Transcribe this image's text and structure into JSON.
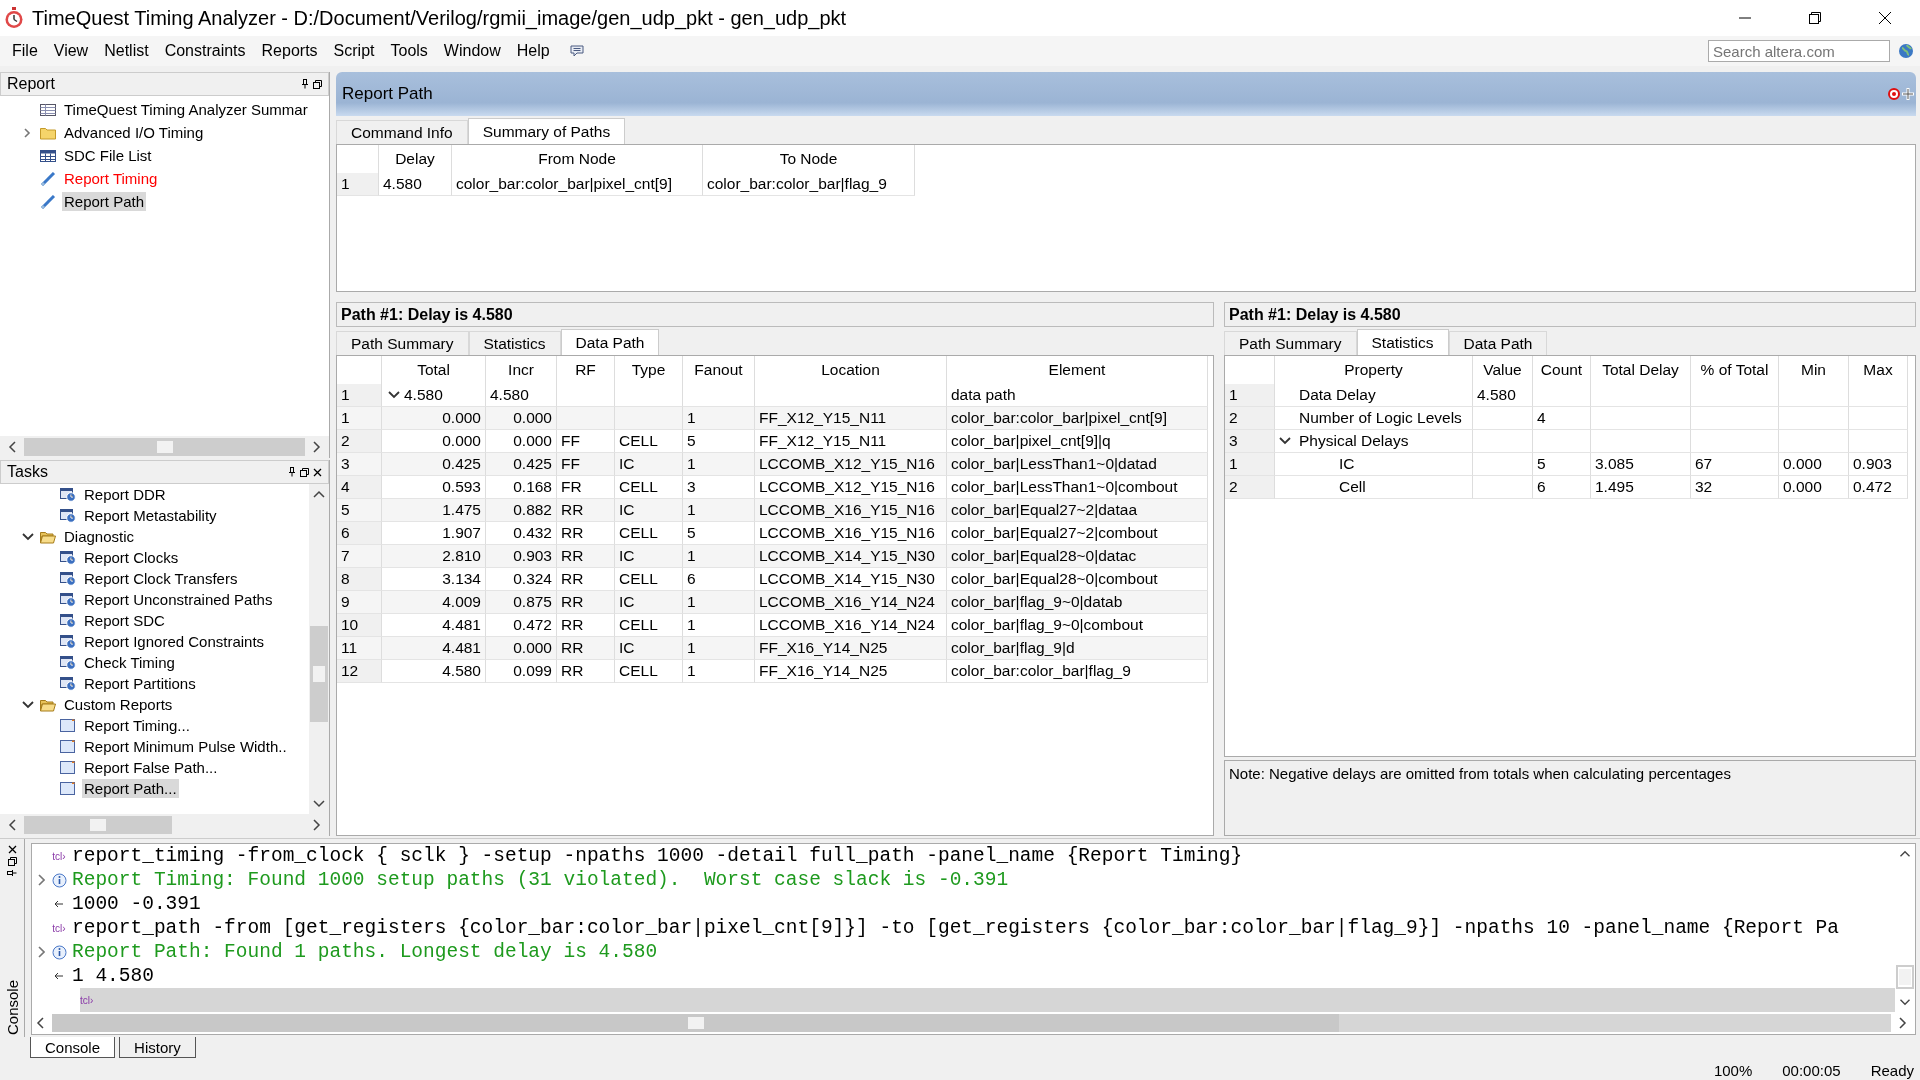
{
  "window": {
    "title": "TimeQuest Timing Analyzer - D:/Document/Verilog/rgmii_image/gen_udp_pkt - gen_udp_pkt"
  },
  "menu": [
    "File",
    "View",
    "Netlist",
    "Constraints",
    "Reports",
    "Script",
    "Tools",
    "Window",
    "Help"
  ],
  "search": {
    "placeholder": "Search altera.com"
  },
  "report_panel": {
    "title": "Report",
    "items": [
      {
        "label": "TimeQuest Timing Analyzer Summar",
        "kind": "summary",
        "color": "#000000",
        "selected": false
      },
      {
        "label": "Advanced I/O Timing",
        "kind": "folder",
        "expanded": false,
        "color": "#000000",
        "selected": false
      },
      {
        "label": "SDC File List",
        "kind": "table",
        "color": "#000000",
        "selected": false
      },
      {
        "label": "Report Timing",
        "kind": "report",
        "color": "#ff0000",
        "selected": false
      },
      {
        "label": "Report Path",
        "kind": "report",
        "color": "#000000",
        "selected": true
      }
    ]
  },
  "tasks_panel": {
    "title": "Tasks",
    "items": [
      {
        "label": "Report DDR",
        "kind": "task",
        "selected": false
      },
      {
        "label": "Report Metastability",
        "kind": "task",
        "selected": false
      },
      {
        "label": "Diagnostic",
        "kind": "folder",
        "expanded": true,
        "selected": false,
        "children": [
          {
            "label": "Report Clocks",
            "kind": "task",
            "selected": false
          },
          {
            "label": "Report Clock Transfers",
            "kind": "task",
            "selected": false
          },
          {
            "label": "Report Unconstrained Paths",
            "kind": "task",
            "selected": false
          },
          {
            "label": "Report SDC",
            "kind": "task",
            "selected": false
          },
          {
            "label": "Report Ignored Constraints",
            "kind": "task",
            "selected": false
          },
          {
            "label": "Check Timing",
            "kind": "task",
            "selected": false
          },
          {
            "label": "Report Partitions",
            "kind": "task",
            "selected": false
          }
        ]
      },
      {
        "label": "Custom Reports",
        "kind": "folder",
        "expanded": true,
        "selected": false,
        "children": [
          {
            "label": "Report Timing...",
            "kind": "custom",
            "selected": false
          },
          {
            "label": "Report Minimum Pulse Width..",
            "kind": "custom",
            "selected": false
          },
          {
            "label": "Report False Path...",
            "kind": "custom",
            "selected": false
          },
          {
            "label": "Report Path...",
            "kind": "custom",
            "selected": true
          }
        ]
      }
    ]
  },
  "report_path": {
    "title": "Report Path",
    "tabs": [
      {
        "label": "Command Info",
        "selected": false
      },
      {
        "label": "Summary of Paths",
        "selected": true
      }
    ],
    "summary_table": {
      "columns": [
        "Delay",
        "From Node",
        "To Node"
      ],
      "rows": [
        {
          "number": "1",
          "cells": [
            "4.580",
            "color_bar:color_bar|pixel_cnt[9]",
            "color_bar:color_bar|flag_9"
          ]
        }
      ]
    }
  },
  "data_path_panel": {
    "title": "Path #1: Delay is 4.580",
    "tabs": [
      {
        "label": "Path Summary",
        "selected": false
      },
      {
        "label": "Statistics",
        "selected": false
      },
      {
        "label": "Data Path",
        "selected": true
      }
    ],
    "table": {
      "columns": [
        "Total",
        "Incr",
        "RF",
        "Type",
        "Fanout",
        "Location",
        "Element"
      ],
      "rows": [
        {
          "number": "1",
          "total": "4.580",
          "incr": "4.580",
          "element": "data path",
          "expanded": true,
          "children": [
            {
              "number": "1",
              "total": "0.000",
              "incr": "0.000",
              "fanout": "1",
              "location": "FF_X12_Y15_N11",
              "element": "color_bar:color_bar|pixel_cnt[9]"
            },
            {
              "number": "2",
              "total": "0.000",
              "incr": "0.000",
              "rf": "FF",
              "type": "CELL",
              "fanout": "5",
              "location": "FF_X12_Y15_N11",
              "element": "color_bar|pixel_cnt[9]|q"
            },
            {
              "number": "3",
              "total": "0.425",
              "incr": "0.425",
              "rf": "FF",
              "type": "IC",
              "fanout": "1",
              "location": "LCCOMB_X12_Y15_N16",
              "element": "color_bar|LessThan1~0|datad"
            },
            {
              "number": "4",
              "total": "0.593",
              "incr": "0.168",
              "rf": "FR",
              "type": "CELL",
              "fanout": "3",
              "location": "LCCOMB_X12_Y15_N16",
              "element": "color_bar|LessThan1~0|combout"
            },
            {
              "number": "5",
              "total": "1.475",
              "incr": "0.882",
              "rf": "RR",
              "type": "IC",
              "fanout": "1",
              "location": "LCCOMB_X16_Y15_N16",
              "element": "color_bar|Equal27~2|dataa"
            },
            {
              "number": "6",
              "total": "1.907",
              "incr": "0.432",
              "rf": "RR",
              "type": "CELL",
              "fanout": "5",
              "location": "LCCOMB_X16_Y15_N16",
              "element": "color_bar|Equal27~2|combout"
            },
            {
              "number": "7",
              "total": "2.810",
              "incr": "0.903",
              "rf": "RR",
              "type": "IC",
              "fanout": "1",
              "location": "LCCOMB_X14_Y15_N30",
              "element": "color_bar|Equal28~0|datac"
            },
            {
              "number": "8",
              "total": "3.134",
              "incr": "0.324",
              "rf": "RR",
              "type": "CELL",
              "fanout": "6",
              "location": "LCCOMB_X14_Y15_N30",
              "element": "color_bar|Equal28~0|combout"
            },
            {
              "number": "9",
              "total": "4.009",
              "incr": "0.875",
              "rf": "RR",
              "type": "IC",
              "fanout": "1",
              "location": "LCCOMB_X16_Y14_N24",
              "element": "color_bar|flag_9~0|datab"
            },
            {
              "number": "10",
              "total": "4.481",
              "incr": "0.472",
              "rf": "RR",
              "type": "CELL",
              "fanout": "1",
              "location": "LCCOMB_X16_Y14_N24",
              "element": "color_bar|flag_9~0|combout"
            },
            {
              "number": "11",
              "total": "4.481",
              "incr": "0.000",
              "rf": "RR",
              "type": "IC",
              "fanout": "1",
              "location": "FF_X16_Y14_N25",
              "element": "color_bar|flag_9|d"
            },
            {
              "number": "12",
              "total": "4.580",
              "incr": "0.099",
              "rf": "RR",
              "type": "CELL",
              "fanout": "1",
              "location": "FF_X16_Y14_N25",
              "element": "color_bar:color_bar|flag_9"
            }
          ]
        }
      ]
    }
  },
  "statistics_panel": {
    "title": "Path #1: Delay is 4.580",
    "tabs": [
      {
        "label": "Path Summary",
        "selected": false
      },
      {
        "label": "Statistics",
        "selected": true
      },
      {
        "label": "Data Path",
        "selected": false
      }
    ],
    "table": {
      "columns": [
        "Property",
        "Value",
        "Count",
        "Total Delay",
        "% of Total",
        "Min",
        "Max"
      ],
      "rows": [
        {
          "number": "1",
          "property": "Data Delay",
          "value": "4.580"
        },
        {
          "number": "2",
          "property": "Number of Logic Levels",
          "count": "4"
        },
        {
          "number": "3",
          "property": "Physical Delays",
          "expanded": true,
          "children": [
            {
              "number": "1",
              "property": "IC",
              "count": "5",
              "total_delay": "3.085",
              "percent": "67",
              "min": "0.000",
              "max": "0.903"
            },
            {
              "number": "2",
              "property": "Cell",
              "count": "6",
              "total_delay": "1.495",
              "percent": "32",
              "min": "0.000",
              "max": "0.472"
            }
          ]
        }
      ]
    },
    "note": "Note: Negative delays are omitted from totals when calculating percentages"
  },
  "console": {
    "side_label": "Console",
    "lines": [
      {
        "kind": "command",
        "label": "tcl›",
        "text": "report_timing -from_clock { sclk } -setup -npaths 1000 -detail full_path -panel_name {Report Timing}"
      },
      {
        "kind": "info",
        "text": "Report Timing: Found 1000 setup paths (31 violated).  Worst case slack is -0.391"
      },
      {
        "kind": "result",
        "text": "1000 -0.391"
      },
      {
        "kind": "command",
        "label": "tcl›",
        "text": "report_path -from [get_registers {color_bar:color_bar|pixel_cnt[9]}] -to [get_registers {color_bar:color_bar|flag_9}] -npaths 10 -panel_name {Report Pa"
      },
      {
        "kind": "info",
        "text": "Report Path: Found 1 paths. Longest delay is 4.580"
      },
      {
        "kind": "result",
        "text": "1 4.580"
      },
      {
        "kind": "prompt",
        "label": "tcl›"
      }
    ],
    "tabs": [
      {
        "label": "Console",
        "selected": true
      },
      {
        "label": "History",
        "selected": false
      }
    ]
  },
  "status_bar": {
    "zoom": "100%",
    "elapsed": "00:00:05",
    "state": "Ready"
  }
}
